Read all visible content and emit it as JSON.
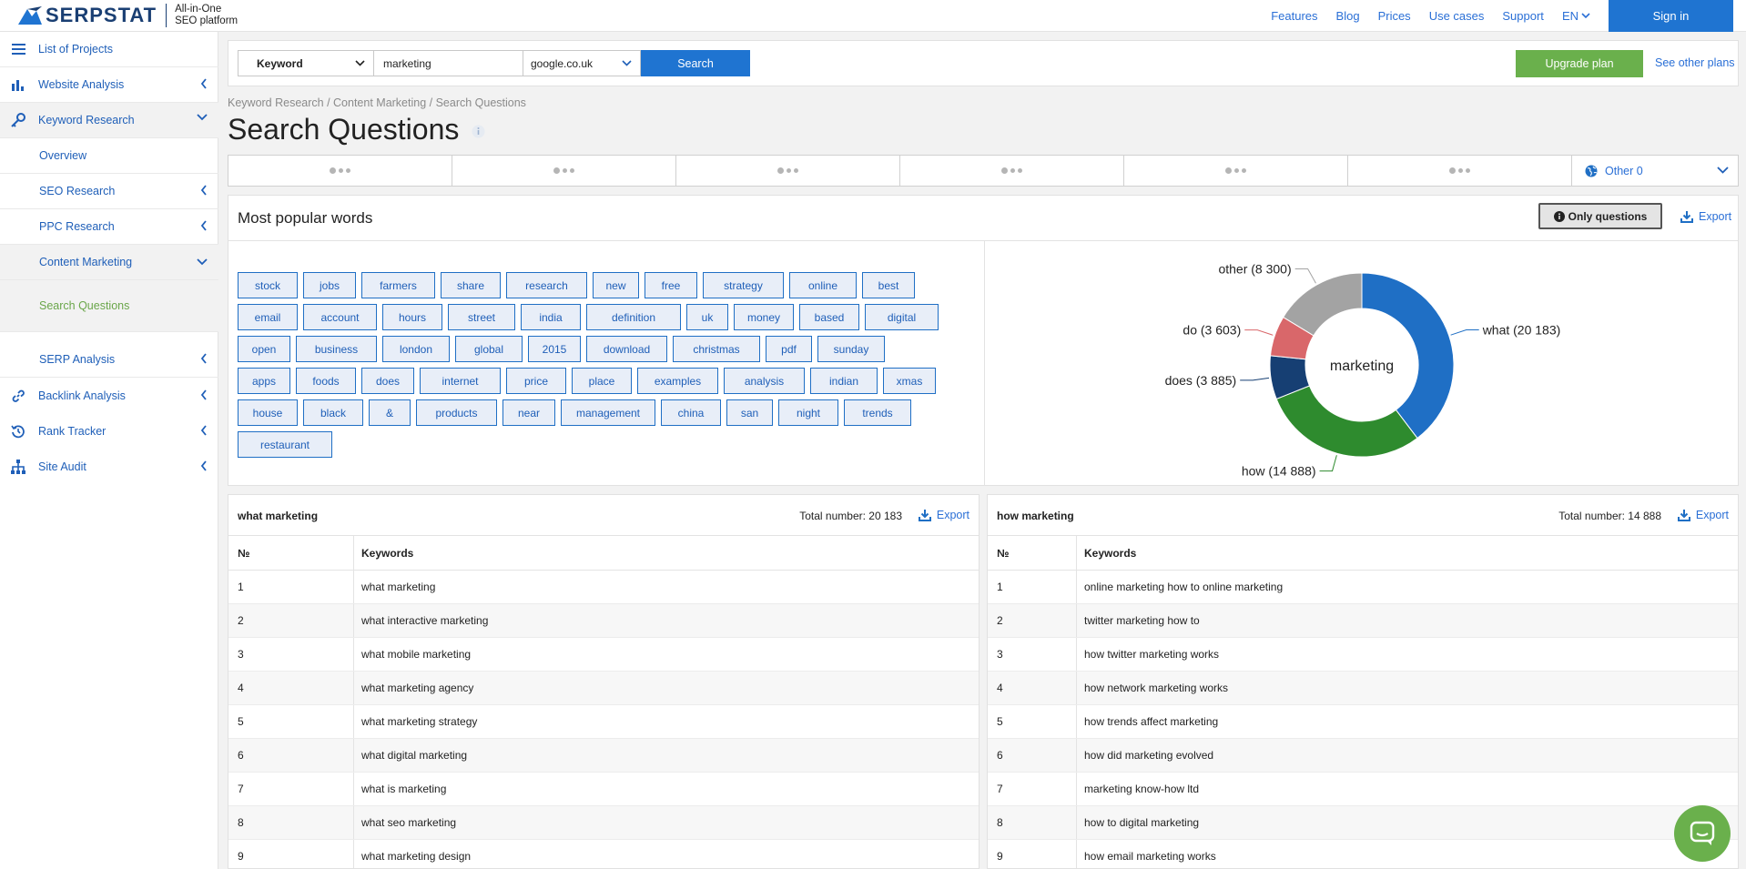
{
  "header": {
    "logo_text": "SERPSTAT",
    "tagline_1": "All-in-One",
    "tagline_2": "SEO platform",
    "nav": [
      "Features",
      "Blog",
      "Prices",
      "Use cases",
      "Support"
    ],
    "lang": "EN",
    "signin": "Sign in"
  },
  "sidebar": {
    "projects": "List of Projects",
    "website_analysis": "Website Analysis",
    "keyword_research": "Keyword Research",
    "overview": "Overview",
    "seo_research": "SEO Research",
    "ppc_research": "PPC Research",
    "content_marketing": "Content Marketing",
    "search_questions": "Search Questions",
    "serp_analysis": "SERP Analysis",
    "backlink_analysis": "Backlink Analysis",
    "rank_tracker": "Rank Tracker",
    "site_audit": "Site Audit"
  },
  "search": {
    "type": "Keyword",
    "query": "marketing",
    "database": "google.co.uk",
    "button": "Search",
    "upgrade": "Upgrade plan",
    "other_plans": "See other plans"
  },
  "breadcrumb": "Keyword Research / Content Marketing / Search Questions",
  "page_title": "Search Questions",
  "tabs": {
    "other": "Other 0"
  },
  "words_panel": {
    "title": "Most popular words",
    "only_questions": "Only questions",
    "export": "Export",
    "rows": [
      [
        "stock",
        "jobs",
        "farmers",
        "share",
        "research",
        "new",
        "free",
        "strategy",
        "online",
        "best"
      ],
      [
        "email",
        "account",
        "hours",
        "street",
        "india",
        "definition",
        "uk",
        "money",
        "based",
        "digital"
      ],
      [
        "open",
        "business",
        "london",
        "global",
        "2015",
        "download",
        "christmas",
        "pdf",
        "sunday"
      ],
      [
        "apps",
        "foods",
        "does",
        "internet",
        "price",
        "place",
        "examples",
        "analysis",
        "indian",
        "xmas"
      ],
      [
        "house",
        "black",
        "&",
        "products",
        "near",
        "management",
        "china",
        "san",
        "night",
        "trends"
      ],
      [
        "restaurant"
      ]
    ]
  },
  "chart_data": {
    "type": "pie",
    "center_label": "marketing",
    "categories": [
      "what",
      "how",
      "does",
      "do",
      "other"
    ],
    "values": [
      20183,
      14888,
      3885,
      3603,
      8300
    ],
    "labels": [
      "what (20 183)",
      "how (14 888)",
      "does (3 885)",
      "do (3 603)",
      "other (8 300)"
    ],
    "colors": [
      "#1f6fc5",
      "#2e8b2e",
      "#163f73",
      "#d9676a",
      "#a3a3a3"
    ]
  },
  "table_left": {
    "title": "what marketing",
    "total": "Total number: 20 183",
    "export": "Export",
    "col_num": "№",
    "col_kw": "Keywords",
    "rows": [
      [
        "1",
        "what marketing"
      ],
      [
        "2",
        "what interactive marketing"
      ],
      [
        "3",
        "what mobile marketing"
      ],
      [
        "4",
        "what marketing agency"
      ],
      [
        "5",
        "what marketing strategy"
      ],
      [
        "6",
        "what digital marketing"
      ],
      [
        "7",
        "what is marketing"
      ],
      [
        "8",
        "what seo marketing"
      ],
      [
        "9",
        "what marketing design"
      ]
    ]
  },
  "table_right": {
    "title": "how marketing",
    "total": "Total number: 14 888",
    "export": "Export",
    "col_num": "№",
    "col_kw": "Keywords",
    "rows": [
      [
        "1",
        "online marketing how to online marketing"
      ],
      [
        "2",
        "twitter marketing how to"
      ],
      [
        "3",
        "how twitter marketing works"
      ],
      [
        "4",
        "how network marketing works"
      ],
      [
        "5",
        "how trends affect marketing"
      ],
      [
        "6",
        "how did marketing evolved"
      ],
      [
        "7",
        "marketing know-how ltd"
      ],
      [
        "8",
        "how to digital marketing"
      ],
      [
        "9",
        "how email marketing works"
      ]
    ]
  }
}
